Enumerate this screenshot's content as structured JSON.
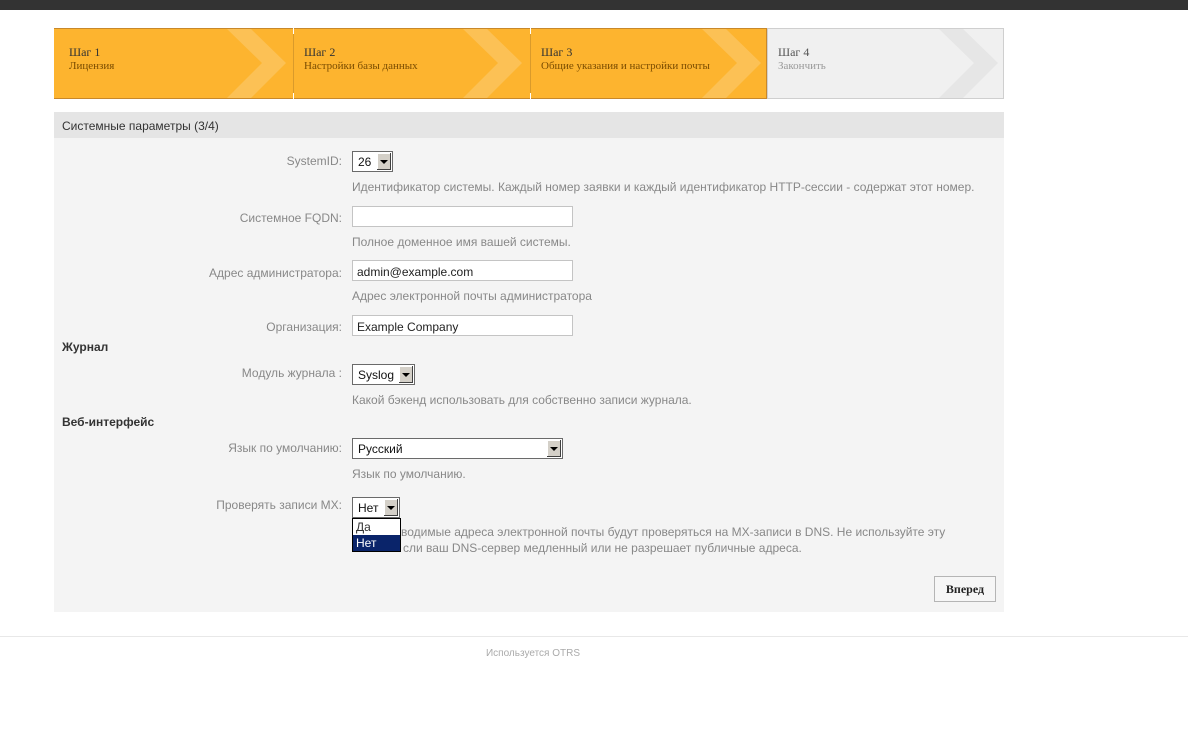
{
  "wizard": {
    "steps": [
      {
        "title": "Шаг 1",
        "subtitle": "Лицензия",
        "state": "done"
      },
      {
        "title": "Шаг 2",
        "subtitle": "Настройки базы данных",
        "state": "done"
      },
      {
        "title": "Шаг 3",
        "subtitle": "Общие указания и настройки почты",
        "state": "done"
      },
      {
        "title": "Шаг 4",
        "subtitle": "Закончить",
        "state": "todo"
      }
    ]
  },
  "panel": {
    "title": "Системные параметры (3/4)",
    "system_id": {
      "label": "SystemID:",
      "value": "26",
      "hint": "Идентификатор системы. Каждый номер заявки и каждый идентификатор HTTP-сессии - содержат этот номер."
    },
    "fqdn": {
      "label": "Системное FQDN:",
      "value": "",
      "hint": "Полное доменное имя вашей системы."
    },
    "admin_email": {
      "label": "Адрес администратора:",
      "value": "admin@example.com",
      "hint": "Адрес электронной почты администратора"
    },
    "organization": {
      "label": "Организация:",
      "value": "Example Company"
    },
    "log_section": "Журнал",
    "log_module": {
      "label": "Модуль журнала :",
      "value": "Syslog",
      "hint": "Какой бэкенд использовать для собственно записи журнала."
    },
    "web_section": "Веб-интерфейс",
    "default_language": {
      "label": "Язык по умолчанию:",
      "value": "Русский",
      "hint": "Язык по умолчанию."
    },
    "check_mx": {
      "label": "Проверять записи MX:",
      "value": "Нет",
      "options": [
        "Да",
        "Нет"
      ],
      "hint_line1": "водимые адреса электронной почты будут проверяться на MX-записи в DNS. Не используйте эту",
      "hint_line2": "сли ваш DNS-сервер медленный или не разрешает публичные адреса."
    },
    "next_button": "Вперед"
  },
  "footer": {
    "text": "Используется OTRS"
  },
  "colors": {
    "step_done": "#fdb42f",
    "step_todo": "#f0f0f0",
    "selected_option": "#0a246a"
  }
}
